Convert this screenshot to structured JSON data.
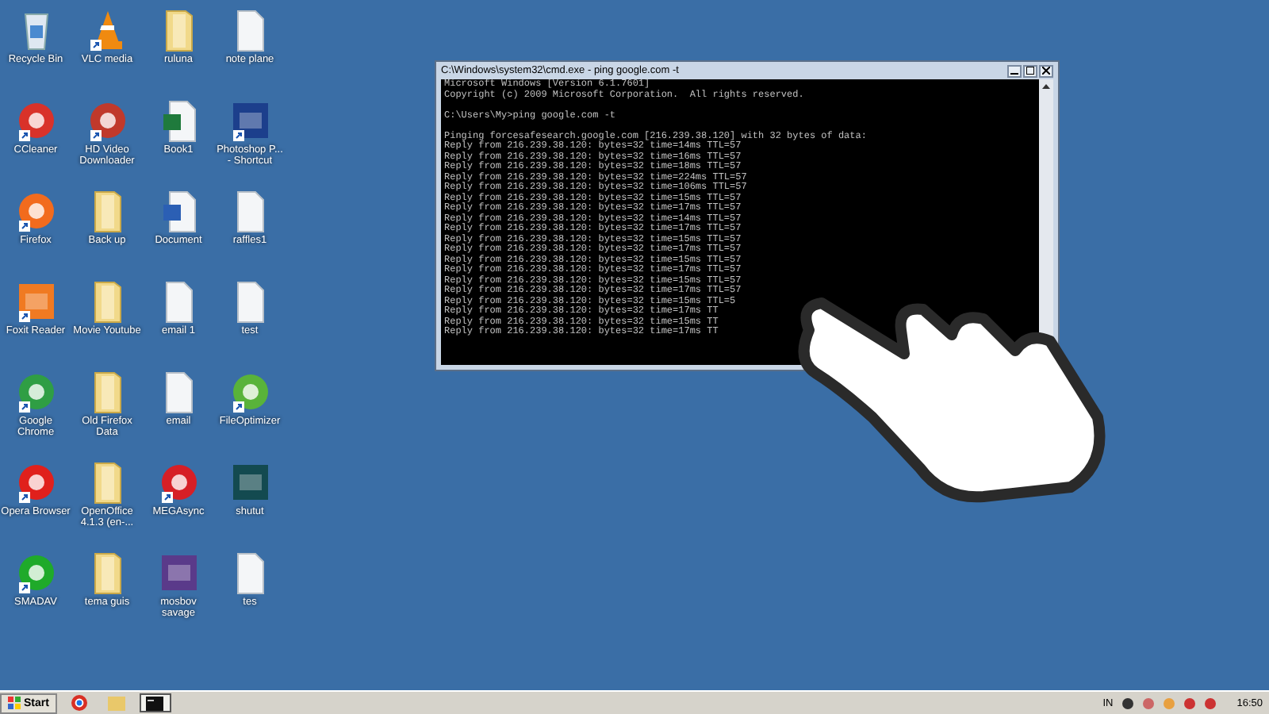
{
  "desktop_icons": [
    {
      "label": "Recycle Bin",
      "kind": "recycle",
      "shortcut": false
    },
    {
      "label": "VLC media",
      "kind": "cone",
      "color": "#f08a10",
      "shortcut": true
    },
    {
      "label": "ruluna",
      "kind": "folder",
      "shortcut": false
    },
    {
      "label": "note plane",
      "kind": "document",
      "shortcut": false
    },
    {
      "label": "CCleaner",
      "kind": "app",
      "color": "#d9322a",
      "shortcut": true
    },
    {
      "label": "HD Video Downloader",
      "kind": "app",
      "color": "#c0392b",
      "shortcut": true
    },
    {
      "label": "Book1",
      "kind": "sheet",
      "color": "#1f7a3c",
      "shortcut": false
    },
    {
      "label": "Photoshop P... - Shortcut",
      "kind": "tile",
      "color": "#1c3f8c",
      "shortcut": true
    },
    {
      "label": "Firefox",
      "kind": "app",
      "color": "#f26b1d",
      "shortcut": true
    },
    {
      "label": "Back up",
      "kind": "folder",
      "shortcut": false
    },
    {
      "label": "Document",
      "kind": "sheet",
      "color": "#2b5fb4",
      "shortcut": false
    },
    {
      "label": "raffles1",
      "kind": "document",
      "shortcut": false
    },
    {
      "label": "Foxit Reader",
      "kind": "tile",
      "color": "#f07a22",
      "shortcut": true
    },
    {
      "label": "Movie Youtube",
      "kind": "folder",
      "shortcut": false
    },
    {
      "label": "email 1",
      "kind": "document",
      "shortcut": false
    },
    {
      "label": "test",
      "kind": "document",
      "shortcut": false
    },
    {
      "label": "Google Chrome",
      "kind": "app",
      "color": "#2f9e44",
      "shortcut": true
    },
    {
      "label": "Old Firefox Data",
      "kind": "folder",
      "shortcut": false
    },
    {
      "label": "email",
      "kind": "document",
      "shortcut": false
    },
    {
      "label": "FileOptimizer",
      "kind": "app",
      "color": "#59b33a",
      "shortcut": true
    },
    {
      "label": "Opera Browser",
      "kind": "app",
      "color": "#e0201c",
      "shortcut": true
    },
    {
      "label": "OpenOffice 4.1.3 (en-...",
      "kind": "folder",
      "shortcut": false
    },
    {
      "label": "MEGAsync",
      "kind": "app",
      "color": "#d61f26",
      "shortcut": true
    },
    {
      "label": "shutut",
      "kind": "tile",
      "color": "#134a50",
      "shortcut": false
    },
    {
      "label": "SMADAV",
      "kind": "app",
      "color": "#1faa2a",
      "shortcut": true
    },
    {
      "label": "tema guis",
      "kind": "folder",
      "shortcut": false
    },
    {
      "label": "mosbov savage",
      "kind": "tile",
      "color": "#5a3a8a",
      "shortcut": false
    },
    {
      "label": "tes",
      "kind": "document",
      "shortcut": false
    }
  ],
  "console_window": {
    "title": "C:\\Windows\\system32\\cmd.exe - ping google.com -t",
    "paragraphs": [
      [
        "Microsoft Windows [Version 6.1.7601]",
        "Copyright (c) 2009 Microsoft Corporation.  All rights reserved."
      ],
      [
        "C:\\Users\\My>ping google.com -t"
      ],
      [
        "Pinging forcesafesearch.google.com [216.239.38.120] with 32 bytes of data:",
        "Reply from 216.239.38.120: bytes=32 time=14ms TTL=57",
        "Reply from 216.239.38.120: bytes=32 time=16ms TTL=57",
        "Reply from 216.239.38.120: bytes=32 time=18ms TTL=57",
        "Reply from 216.239.38.120: bytes=32 time=224ms TTL=57",
        "Reply from 216.239.38.120: bytes=32 time=106ms TTL=57",
        "Reply from 216.239.38.120: bytes=32 time=15ms TTL=57",
        "Reply from 216.239.38.120: bytes=32 time=17ms TTL=57",
        "Reply from 216.239.38.120: bytes=32 time=14ms TTL=57",
        "Reply from 216.239.38.120: bytes=32 time=17ms TTL=57",
        "Reply from 216.239.38.120: bytes=32 time=15ms TTL=57",
        "Reply from 216.239.38.120: bytes=32 time=17ms TTL=57",
        "Reply from 216.239.38.120: bytes=32 time=15ms TTL=57",
        "Reply from 216.239.38.120: bytes=32 time=17ms TTL=57",
        "Reply from 216.239.38.120: bytes=32 time=15ms TTL=57",
        "Reply from 216.239.38.120: bytes=32 time=17ms TTL=57",
        "Reply from 216.239.38.120: bytes=32 time=15ms TTL=5",
        "Reply from 216.239.38.120: bytes=32 time=17ms TT",
        "Reply from 216.239.38.120: bytes=32 time=15ms TT",
        "Reply from 216.239.38.120: bytes=32 time=17ms TT"
      ]
    ]
  },
  "taskbar": {
    "start_label": "Start",
    "apps": [
      {
        "kind": "browser",
        "selected": false
      },
      {
        "kind": "explorer",
        "selected": false
      },
      {
        "kind": "console",
        "selected": true
      }
    ],
    "language": "IN",
    "clock": "16:50"
  }
}
